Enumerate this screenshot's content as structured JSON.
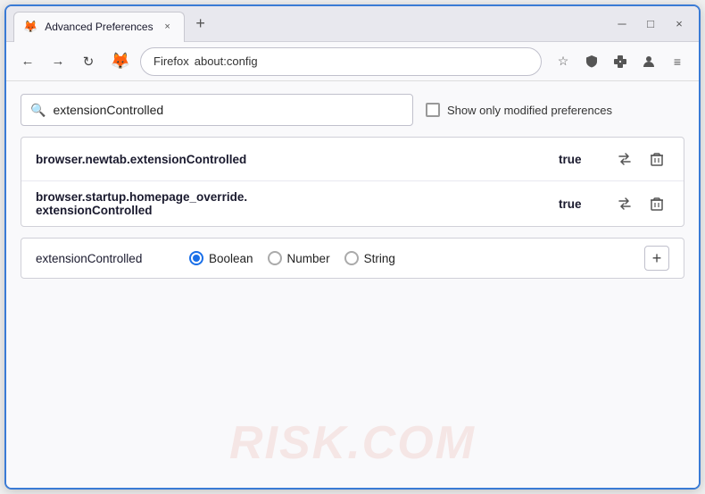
{
  "window": {
    "title": "Advanced Preferences",
    "tab_close": "×",
    "new_tab": "+",
    "minimize": "─",
    "maximize": "□",
    "close": "×"
  },
  "nav": {
    "back": "←",
    "forward": "→",
    "reload": "↻",
    "browser_name": "Firefox",
    "address": "about:config",
    "star": "☆",
    "shield": "⛨",
    "extension": "🧩",
    "account": "👤",
    "menu": "≡"
  },
  "search": {
    "placeholder": "",
    "value": "extensionControlled",
    "show_modified_label": "Show only modified preferences"
  },
  "results": [
    {
      "name": "browser.newtab.extensionControlled",
      "value": "true"
    },
    {
      "name_line1": "browser.startup.homepage_override.",
      "name_line2": "extensionControlled",
      "value": "true"
    }
  ],
  "add_preference": {
    "name": "extensionControlled",
    "type_boolean": "Boolean",
    "type_number": "Number",
    "type_string": "String",
    "add_label": "+"
  },
  "watermark": "RISK.COM",
  "icons": {
    "search": "🔍",
    "swap": "⇌",
    "delete": "🗑",
    "add": "+"
  }
}
